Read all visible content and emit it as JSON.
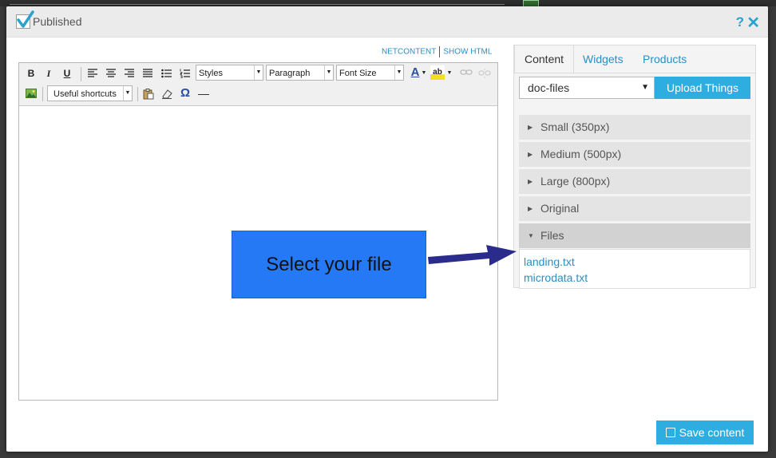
{
  "dialog": {
    "published_label": "Published",
    "help_icon": "?",
    "close_icon": "✕"
  },
  "view_links": {
    "netcontent": "NETCONTENT",
    "show_html": "SHOW HTML"
  },
  "toolbar": {
    "bold": "B",
    "italic": "I",
    "underline": "U",
    "styles": "Styles",
    "paragraph": "Paragraph",
    "font_size": "Font Size",
    "font_color": "A",
    "highlight": "ab",
    "shortcuts": "Useful shortcuts",
    "omega": "Ω",
    "hr": "—"
  },
  "callout": {
    "text": "Select your file"
  },
  "panel": {
    "tabs": [
      "Content",
      "Widgets",
      "Products"
    ],
    "folder_value": "doc-files",
    "upload_label": "Upload Things",
    "sections": [
      "Small (350px)",
      "Medium (500px)",
      "Large (800px)",
      "Original",
      "Files"
    ],
    "files": [
      "landing.txt",
      "microdata.txt"
    ]
  },
  "footer": {
    "save_label": "Save content"
  },
  "colors": {
    "accent": "#2eaee0",
    "link": "#2a8fc4",
    "callout": "#2679f5",
    "arrow": "#2b2b8c"
  }
}
